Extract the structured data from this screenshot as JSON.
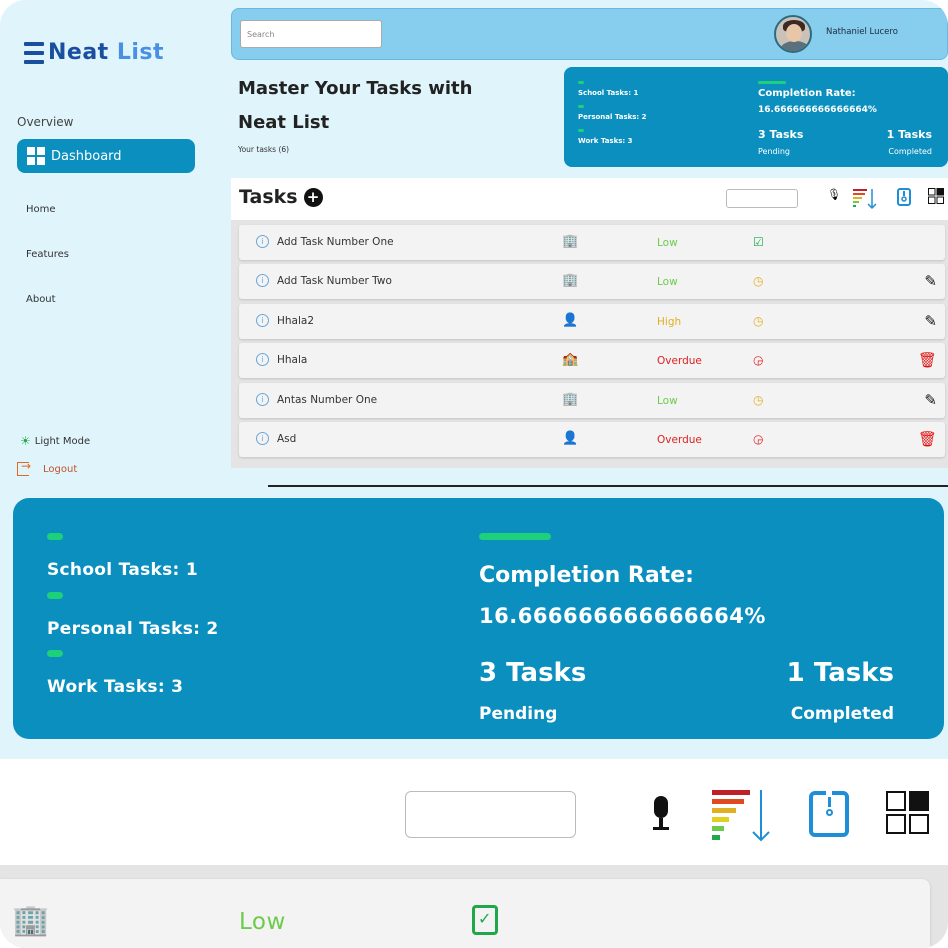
{
  "app": {
    "logo_neat": "Neat",
    "logo_list": "List",
    "search_placeholder": "Search",
    "user_name": "Nathaniel Lucero"
  },
  "sidebar": {
    "section_label": "Overview",
    "dashboard_label": "Dashboard",
    "nav_items": [
      "Home",
      "Features",
      "About"
    ],
    "light_mode_label": "Light Mode",
    "logout_label": "Logout"
  },
  "hero": {
    "headline_line1": "Master Your Tasks with",
    "headline_line2": "Neat List",
    "your_tasks": "Your tasks (6)"
  },
  "stats": {
    "school": "School Tasks: 1",
    "personal": "Personal Tasks: 2",
    "work": "Work Tasks: 3",
    "completion_title": "Completion Rate:",
    "completion_value": "16.666666666666664%",
    "pending_count": "3 Tasks",
    "pending_label": "Pending",
    "completed_count": "1 Tasks",
    "completed_label": "Completed",
    "accent_color": "#0a8fbf",
    "indicator_color": "#1fd07a"
  },
  "tasks_section": {
    "title": "Tasks",
    "add_icon": "plus-circle-icon",
    "tools": [
      "microphone-icon",
      "priority-sort-icon",
      "archive-zip-icon",
      "grid-view-icon"
    ]
  },
  "tasks": [
    {
      "name": "Add Task Number One",
      "category_icon": "building-icon",
      "priority": "Low",
      "priority_color": "#6ccb4c",
      "status_icon": "clipboard-check-icon",
      "action_icon": ""
    },
    {
      "name": "Add Task Number Two",
      "category_icon": "building-icon",
      "priority": "Low",
      "priority_color": "#6ccb4c",
      "status_icon": "clock-icon",
      "action_icon": "edit-icon"
    },
    {
      "name": "Hhala2",
      "category_icon": "person-icon",
      "priority": "High",
      "priority_color": "#e0b020",
      "status_icon": "clock-icon",
      "action_icon": "edit-icon"
    },
    {
      "name": "Hhala",
      "category_icon": "school-icon",
      "priority": "Overdue",
      "priority_color": "#e02020",
      "status_icon": "overdue-clock-icon",
      "action_icon": "trash-icon"
    },
    {
      "name": "Antas Number One",
      "category_icon": "building-icon",
      "priority": "Low",
      "priority_color": "#6ccb4c",
      "status_icon": "clock-icon",
      "action_icon": "edit-icon"
    },
    {
      "name": "Asd",
      "category_icon": "person-icon",
      "priority": "Overdue",
      "priority_color": "#e02020",
      "status_icon": "overdue-clock-icon",
      "action_icon": "trash-icon"
    }
  ],
  "zoom_row": {
    "priority": "Low"
  }
}
